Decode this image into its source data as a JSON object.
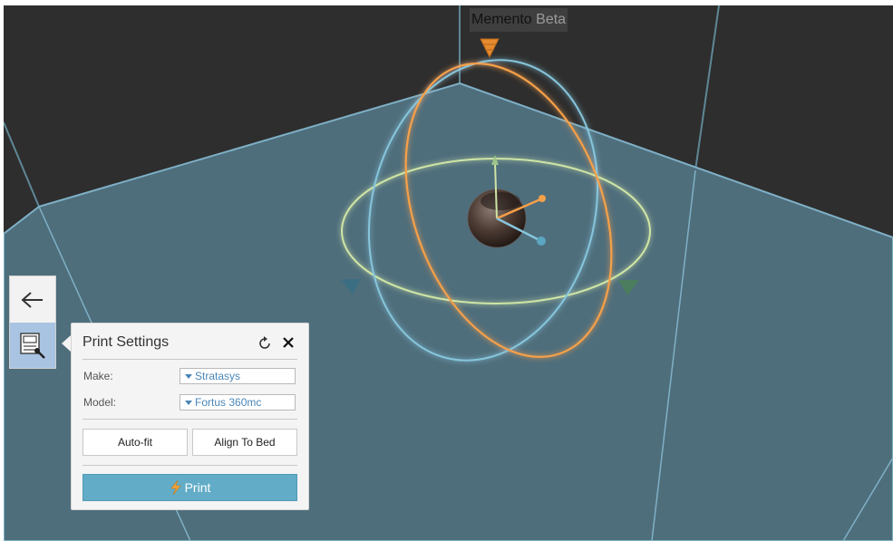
{
  "app": {
    "name": "Memento",
    "badge": "Beta"
  },
  "toolbar": {
    "back_icon": "arrow-left-icon",
    "print_settings_icon": "print-settings-icon"
  },
  "print_settings": {
    "title": "Print Settings",
    "reset_icon": "reset-icon",
    "close_icon": "close-icon",
    "make": {
      "label": "Make:",
      "value": "Stratasys"
    },
    "model": {
      "label": "Model:",
      "value": "Fortus 360mc"
    },
    "auto_fit_label": "Auto-fit",
    "align_to_bed_label": "Align To Bed",
    "print_label": "Print",
    "print_icon": "lightning-icon"
  },
  "colors": {
    "viewport_bg": "#2e2e2e",
    "bed_fill": "#4f6e7c",
    "bed_edge": "#7fb0c6",
    "ring_x": "#f5a04a",
    "ring_y": "#86c6dc",
    "ring_z": "#cfe5a5",
    "accent": "#62acc7",
    "select_text": "#4a86b8"
  }
}
